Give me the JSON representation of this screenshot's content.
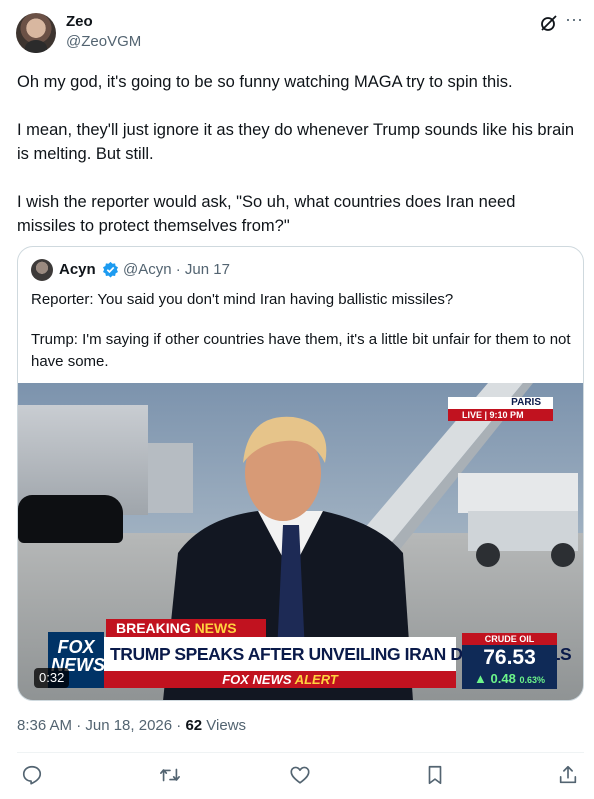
{
  "author": {
    "name": "Zeo",
    "handle": "@ZeoVGM"
  },
  "tweet": {
    "paragraphs": [
      "Oh my god, it's going to be so funny watching MAGA try to spin this.",
      "I mean, they'll just ignore it as they do whenever Trump sounds like his brain is melting. But still.",
      "I wish the reporter would ask, \"So uh, what countries does Iran need missiles to protect themselves from?\""
    ]
  },
  "quote": {
    "name": "Acyn",
    "handle_date": "@Acyn · Jun 17",
    "paragraphs": [
      "Reporter: You said you don't mind Iran having ballistic missiles?",
      "Trump: I'm saying if other countries have them, it's a little bit unfair for them to not have some."
    ],
    "video": {
      "duration": "0:32",
      "breaking": "BREAKING",
      "breaking_news": "NEWS",
      "headline": "TRUMP SPEAKS AFTER UNVEILING IRAN DEAL DETAILS",
      "alert_prefix": "FOX NEWS",
      "alert_word": "ALERT",
      "logo_top": "FOX",
      "logo_bottom": "NEWS",
      "location": "PARIS",
      "live": "LIVE",
      "time": "9:10 PM",
      "ticker_label": "CRUDE OIL",
      "ticker_value": "76.53",
      "ticker_change": "▲ 0.48",
      "ticker_pct": "0.63%"
    }
  },
  "meta": {
    "time_date": "8:36 AM · Jun 18, 2026 · ",
    "views_count": "62",
    "views_label": " Views"
  },
  "icons": {
    "grok": "grok-icon",
    "more": "more-icon",
    "verified": "verified-badge-icon",
    "reply": "reply-icon",
    "retweet": "retweet-icon",
    "like": "like-icon",
    "bookmark": "bookmark-icon",
    "share": "share-icon"
  },
  "colors": {
    "text": "#0f1419",
    "secondary": "#536471",
    "verified": "#1d9bf0",
    "border": "#cfd9de"
  }
}
